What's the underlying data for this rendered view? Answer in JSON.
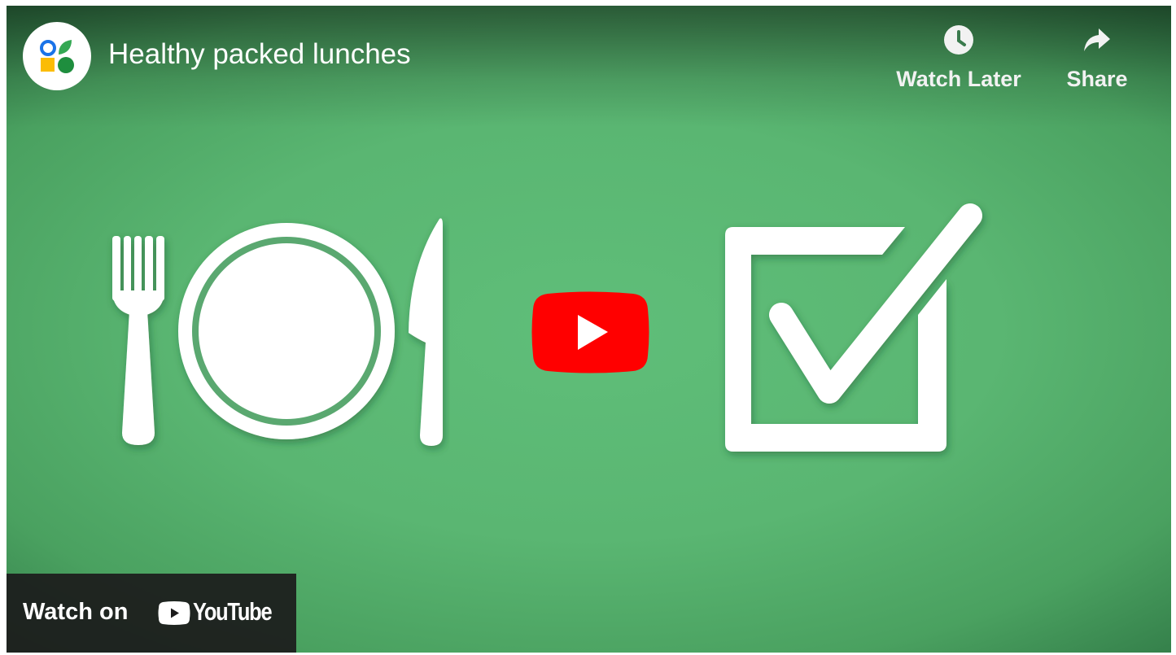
{
  "video": {
    "title": "Healthy packed lunches"
  },
  "actions": {
    "watch_later_label": "Watch Later",
    "share_label": "Share"
  },
  "watch_on": {
    "label": "Watch on",
    "brand": "YouTube"
  },
  "icons": {
    "channel_avatar": "channel-logo-icon",
    "watch_later": "clock-icon",
    "share": "share-arrow-icon",
    "play": "youtube-play-icon",
    "fork": "fork-icon",
    "plate": "plate-icon",
    "knife": "knife-icon",
    "checkbox": "checked-box-icon"
  },
  "colors": {
    "background_green": "#5ab672",
    "play_red": "#ff0000",
    "logo_blue": "#1a73e8",
    "logo_green": "#34a853",
    "logo_yellow": "#fbbc04",
    "logo_dark_green": "#1e8e3e"
  }
}
